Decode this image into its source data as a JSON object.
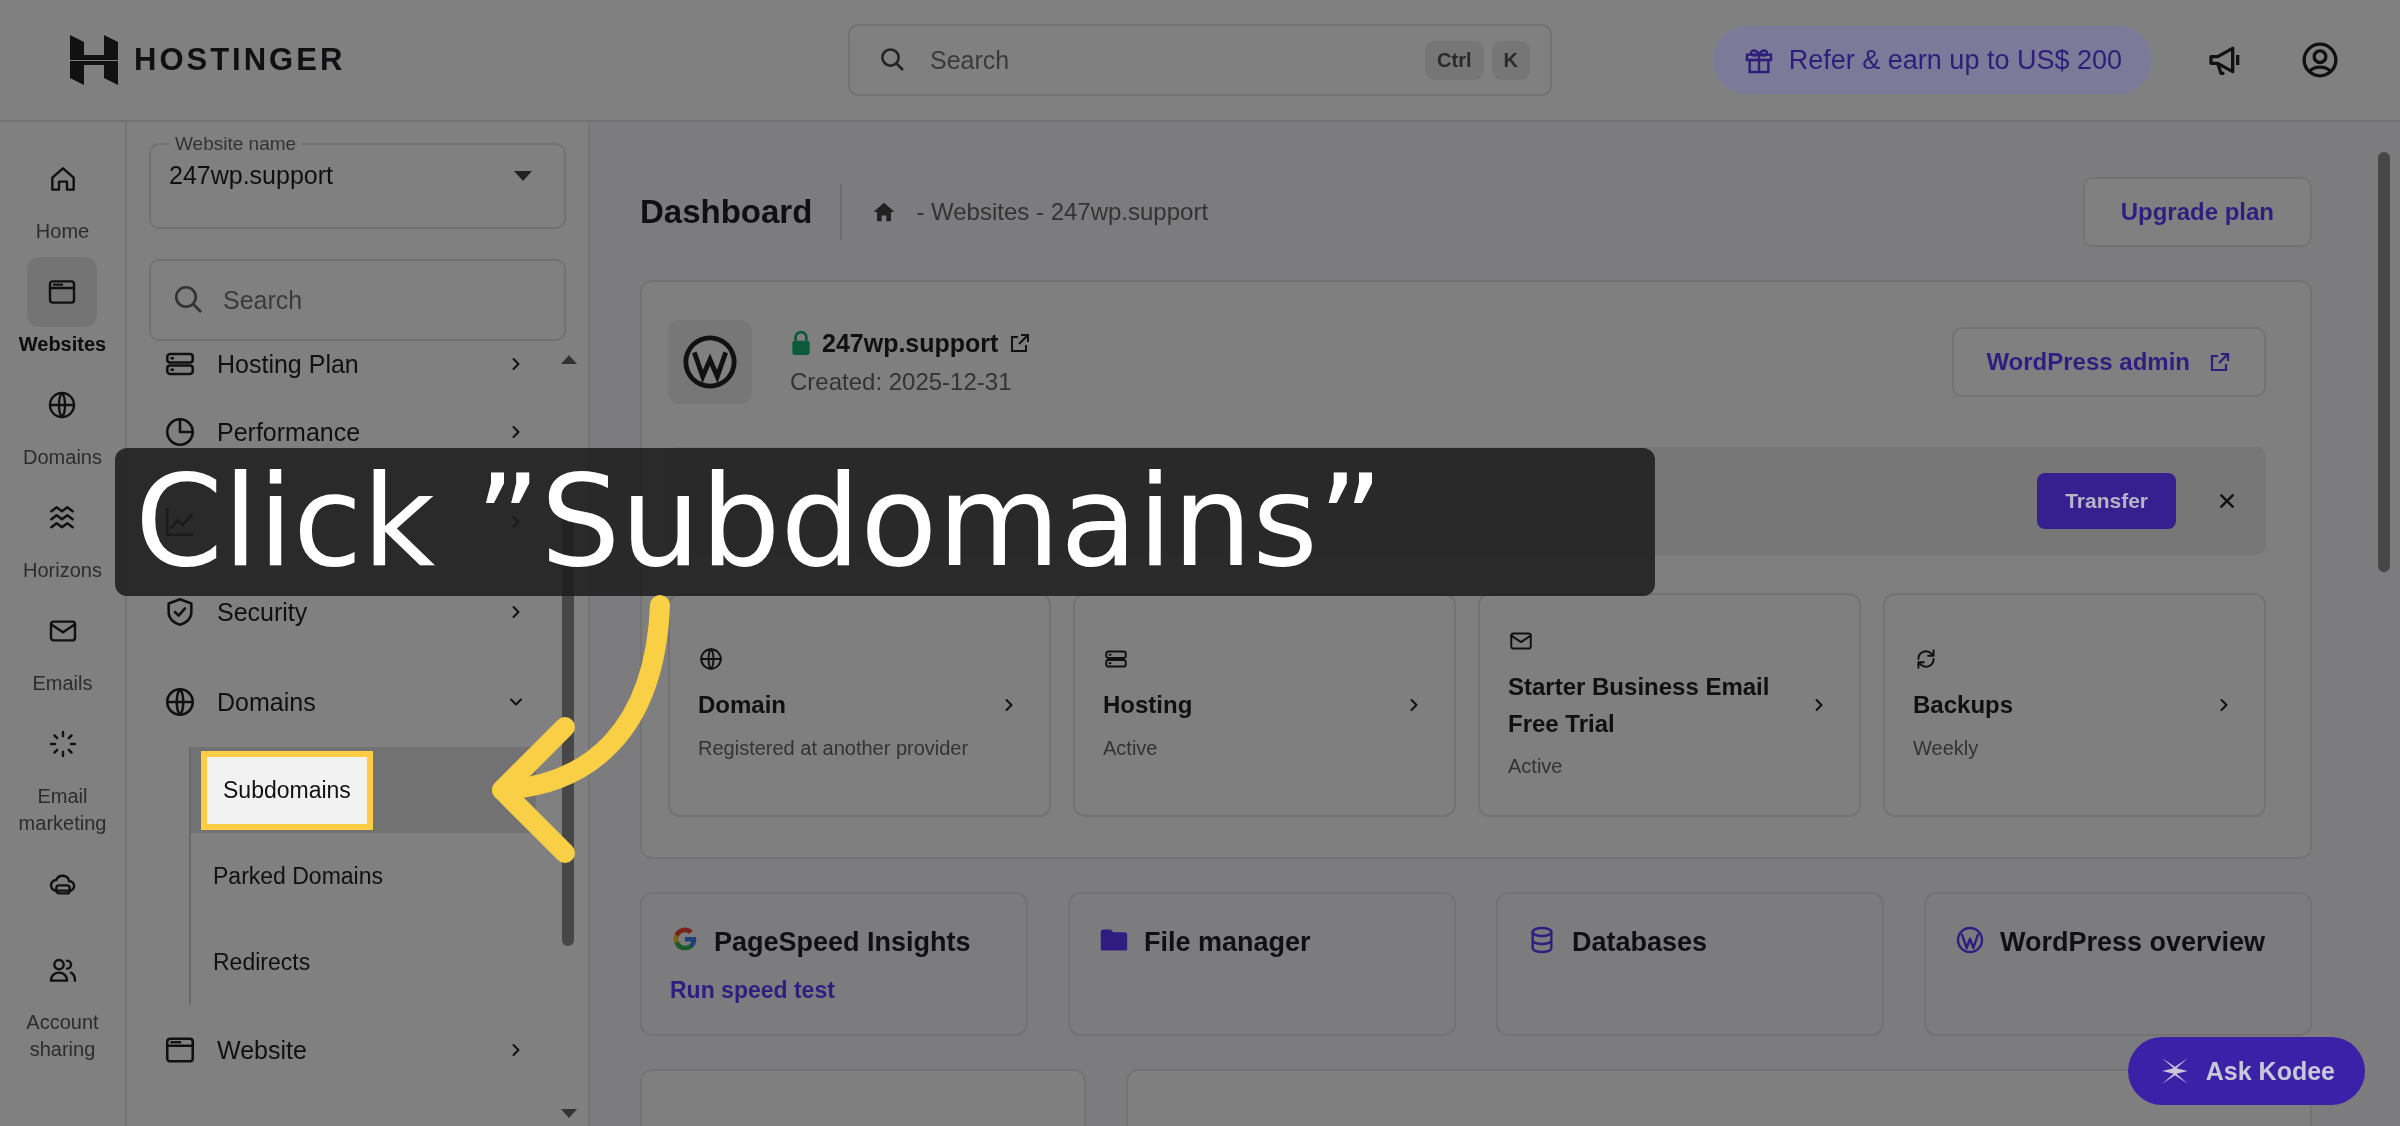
{
  "header": {
    "logo": "HOSTINGER",
    "search": {
      "placeholder": "Search",
      "keys": [
        "Ctrl",
        "K"
      ]
    },
    "refer": "Refer & earn up to US$ 200"
  },
  "rail": [
    {
      "label": "Home",
      "selected": false
    },
    {
      "label": "Websites",
      "selected": true
    },
    {
      "label": "Domains",
      "selected": false
    },
    {
      "label": "Horizons",
      "selected": false
    },
    {
      "label": "Emails",
      "selected": false
    },
    {
      "label": "Email marketing",
      "selected": false
    },
    {
      "selected": false
    },
    {
      "label": "Account sharing",
      "selected": false
    }
  ],
  "sidebar": {
    "website_field": {
      "label": "Website name",
      "value": "247wp.support"
    },
    "search": {
      "placeholder": "Search"
    },
    "items": [
      {
        "label": "Hosting Plan",
        "expanded": false
      },
      {
        "label": "Performance",
        "expanded": false
      },
      {
        "expanded": false
      },
      {
        "label": "Security",
        "expanded": false
      },
      {
        "label": "Domains",
        "expanded": true,
        "children": [
          {
            "label": "Subdomains",
            "selected": true
          },
          {
            "label": "Parked Domains",
            "selected": false
          },
          {
            "label": "Redirects",
            "selected": false
          }
        ]
      },
      {
        "label": "Website",
        "expanded": false
      }
    ]
  },
  "main": {
    "title": "Dashboard",
    "breadcrumb": "- Websites - 247wp.support",
    "upgrade": "Upgrade plan",
    "site": {
      "name": "247wp.support",
      "created": "Created: 2025-12-31",
      "admin_button": "WordPress admin"
    },
    "notice": {
      "button": "Transfer"
    },
    "stats": [
      {
        "title": "Domain",
        "subtitle": "Registered at another provider"
      },
      {
        "title": "Hosting",
        "subtitle": "Active"
      },
      {
        "title": "Starter Business Email Free Trial",
        "subtitle": "Active"
      },
      {
        "title": "Backups",
        "subtitle": "Weekly"
      }
    ],
    "tools": [
      {
        "title": "PageSpeed Insights",
        "link": "Run speed test"
      },
      {
        "title": "File manager"
      },
      {
        "title": "Databases"
      },
      {
        "title": "WordPress overview"
      }
    ],
    "assistant": "Ask Kodee"
  },
  "tutorial": {
    "caption": "Click ”Subdomains”"
  }
}
